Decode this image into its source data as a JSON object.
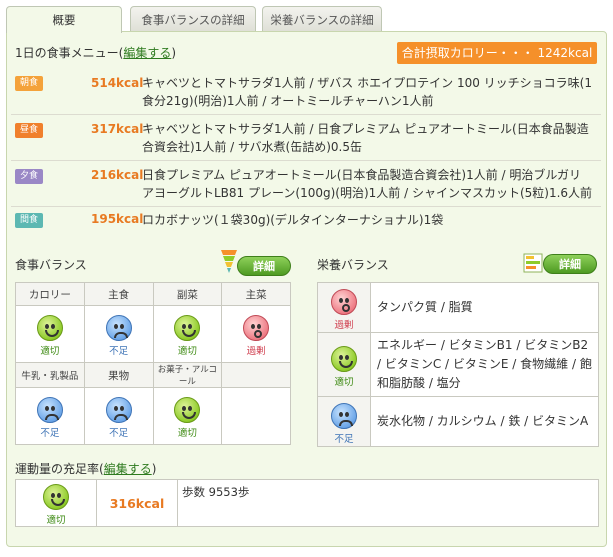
{
  "tabs": [
    {
      "label": "概要",
      "active": true
    },
    {
      "label": "食事バランスの詳細",
      "active": false
    },
    {
      "label": "栄養バランスの詳細",
      "active": false
    }
  ],
  "menu": {
    "title_prefix": "1日の食事メニュー(",
    "edit_link": "編集する",
    "title_suffix": ")",
    "total_calories": "合計摂取カロリー・・・ 1242kcal"
  },
  "meals": [
    {
      "badge": "朝食",
      "badge_color": "#f4a23a",
      "kcal": "514kcal",
      "lines": [
        "キャベツとトマトサラダ1人前 / ザバス ホエイプロテイン 100 リッチショコラ味(1",
        "食分21g)(明治)1人前 / オートミールチャーハン1人前"
      ]
    },
    {
      "badge": "昼食",
      "badge_color": "#f0802c",
      "kcal": "317kcal",
      "lines": [
        "キャベツとトマトサラダ1人前 / 日食プレミアム ピュアオートミール(日本食品製造",
        "合資会社)1人前 / サバ水煮(缶詰め)0.5缶"
      ]
    },
    {
      "badge": "夕食",
      "badge_color": "#9a88c6",
      "kcal": "216kcal",
      "lines": [
        "日食プレミアム ピュアオートミール(日本食品製造合資会社)1人前 / 明治ブルガリ",
        "アヨーグルトLB81 プレーン(100g)(明治)1人前 / シャインマスカット(5粒)1.6人前"
      ]
    },
    {
      "badge": "間食",
      "badge_color": "#5cb8b2",
      "kcal": "195kcal",
      "lines": [
        "ロカボナッツ(１袋30g)(デルタインターナショナル)1袋"
      ]
    }
  ],
  "food_balance": {
    "title": "食事バランス",
    "detail_label": "詳細",
    "row1": [
      {
        "header": "カロリー",
        "status": "good",
        "label": "適切"
      },
      {
        "header": "主食",
        "status": "low",
        "label": "不足"
      },
      {
        "header": "副菜",
        "status": "good",
        "label": "適切"
      },
      {
        "header": "主菜",
        "status": "over",
        "label": "過剰"
      }
    ],
    "row2": [
      {
        "header": "牛乳・乳製品",
        "status": "low",
        "label": "不足"
      },
      {
        "header": "果物",
        "status": "low",
        "label": "不足"
      },
      {
        "header": "お菓子・アルコール",
        "status": "good",
        "label": "適切"
      }
    ]
  },
  "nutrition_balance": {
    "title": "栄養バランス",
    "detail_label": "詳細",
    "rows": [
      {
        "status": "over",
        "label": "過剰",
        "text": "タンパク質 / 脂質"
      },
      {
        "status": "good",
        "label": "適切",
        "text": "エネルギー / ビタミンB1 / ビタミンB2 / ビタミンC / ビタミンE / 食物繊維 / 飽和脂肪酸 / 塩分"
      },
      {
        "status": "low",
        "label": "不足",
        "text": "炭水化物 / カルシウム / 鉄 / ビタミンA"
      }
    ]
  },
  "exercise": {
    "title_prefix": "運動量の充足率(",
    "edit_link": "編集する",
    "title_suffix": ")",
    "status": "good",
    "label": "適切",
    "kcal": "316kcal",
    "steps": "歩数 9553歩"
  },
  "colors": {
    "accent_green": "#2d7a1e",
    "kcal_orange": "#e87a22",
    "total_bg": "#f5902a"
  }
}
